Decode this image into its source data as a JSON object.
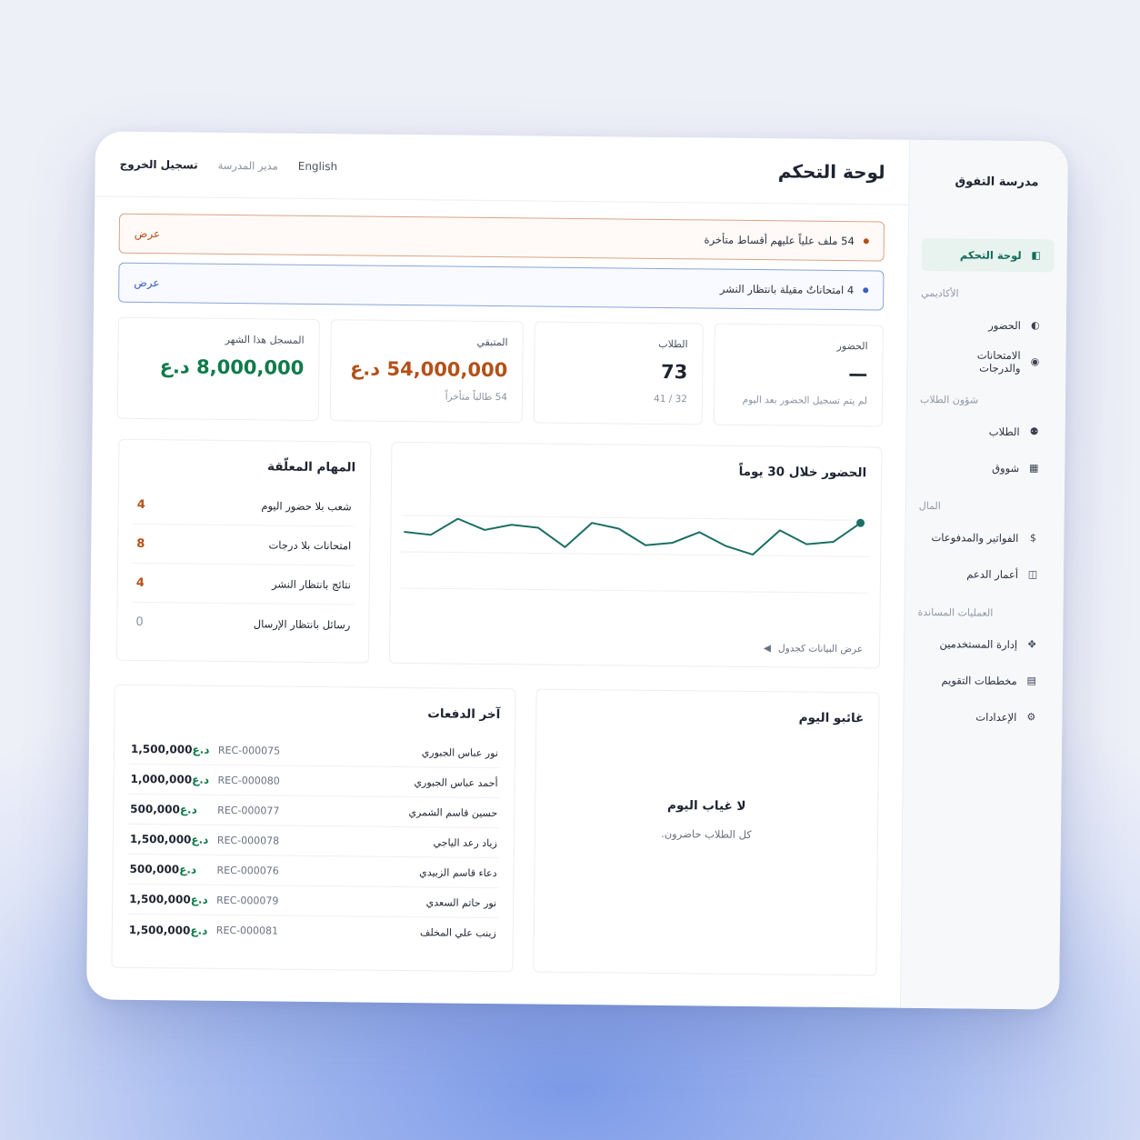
{
  "sidebar": {
    "brand": "مدرسة التفوق",
    "items": [
      {
        "label": "لوحة التحكم",
        "icon": "dashboard-icon"
      },
      {
        "group": "الأكاديمي"
      },
      {
        "label": "الحضور",
        "icon": "contrast-icon"
      },
      {
        "label": "الامتحانات والدرجات",
        "icon": "exam-icon"
      },
      {
        "group": "شؤون الطلاب"
      },
      {
        "label": "الطلاب",
        "icon": "users-icon"
      },
      {
        "label": "شووق",
        "icon": "calculator-icon"
      },
      {
        "group": "المال"
      },
      {
        "label": "الفواتير والمدفوعات",
        "icon": "dollar-icon"
      },
      {
        "label": "أعمار الدعم",
        "icon": "book-icon"
      },
      {
        "group": "العمليات المساندة"
      },
      {
        "label": "إدارة المستخدمين",
        "icon": "cog-icon"
      },
      {
        "label": "مخططات التقويم",
        "icon": "calendar-icon"
      },
      {
        "label": "الإعدادات",
        "icon": "settings-icon"
      }
    ]
  },
  "topbar": {
    "title": "لوحة التحكم",
    "lang": "English",
    "role": "مدير المدرسة",
    "logout": "تسجيل الخروج"
  },
  "alerts": [
    {
      "text": "54 ملف علياً عليهم أقساط متأخرة",
      "action": "عرض"
    },
    {
      "text": "4 امتحاناتٌ مقيلة بانتظار النشر",
      "action": "عرض"
    }
  ],
  "stats": {
    "attendance": {
      "label": "الحضور",
      "value": "—",
      "sub": "لم يتم تسجيل الحضور بعد اليوم"
    },
    "students": {
      "label": "الطلاب",
      "value": "73",
      "sub": "41 / 32"
    },
    "due": {
      "label": "المتبقي",
      "value": "54,000,000 د.ع",
      "sub": "54 طالباً متأخراً"
    },
    "month": {
      "label": "المسجل هذا الشهر",
      "value": "8,000,000 د.ع"
    }
  },
  "chart": {
    "title": "الحضور خلال 30 يوماً",
    "footer": "عرض البيانات كجدول",
    "accent": "#1b6f64"
  },
  "chart_data": {
    "type": "line",
    "title": "الحضور خلال 30 يوماً",
    "values": [
      88,
      87,
      93,
      89,
      91,
      90,
      83,
      92,
      90,
      84,
      85,
      89,
      84,
      81,
      90,
      85,
      86,
      93
    ]
  },
  "tasks": {
    "title": "المهام المعلّقة",
    "items": [
      {
        "label": "شعب بلا حضور اليوم",
        "count": "4"
      },
      {
        "label": "امتحانات بلا درجات",
        "count": "8"
      },
      {
        "label": "نتائج بانتظار النشر",
        "count": "4"
      },
      {
        "label": "رسائل بانتظار الإرسال",
        "count": "0"
      }
    ]
  },
  "absent": {
    "title": "غائبو اليوم",
    "heading": "لا غياب اليوم",
    "sub": "كل الطلاب حاضرون."
  },
  "payments": {
    "title": "آخر الدفعات",
    "currency": "د.ع",
    "rows": [
      {
        "name": "نور عباس الجبوري",
        "rec": "REC-000075",
        "amount": "1,500,000"
      },
      {
        "name": "أحمد عباس الجبوري",
        "rec": "REC-000080",
        "amount": "1,000,000"
      },
      {
        "name": "حسين قاسم الشمري",
        "rec": "REC-000077",
        "amount": "500,000"
      },
      {
        "name": "زياد رعد الياجي",
        "rec": "REC-000078",
        "amount": "1,500,000"
      },
      {
        "name": "دعاء قاسم الزبيدي",
        "rec": "REC-000076",
        "amount": "500,000"
      },
      {
        "name": "نور حاتم السعدي",
        "rec": "REC-000079",
        "amount": "1,500,000"
      },
      {
        "name": "زينب علي المخلف",
        "rec": "REC-000081",
        "amount": "1,500,000"
      }
    ]
  }
}
